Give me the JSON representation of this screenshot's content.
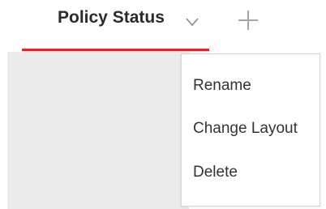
{
  "tab": {
    "label": "Policy Status",
    "accent_color": "#e0262f",
    "dropdown_icon": "chevron-down-icon"
  },
  "add_tab": {
    "icon": "plus-icon"
  },
  "context_menu": {
    "items": [
      {
        "label": "Rename"
      },
      {
        "label": "Change Layout"
      },
      {
        "label": "Delete"
      }
    ]
  }
}
